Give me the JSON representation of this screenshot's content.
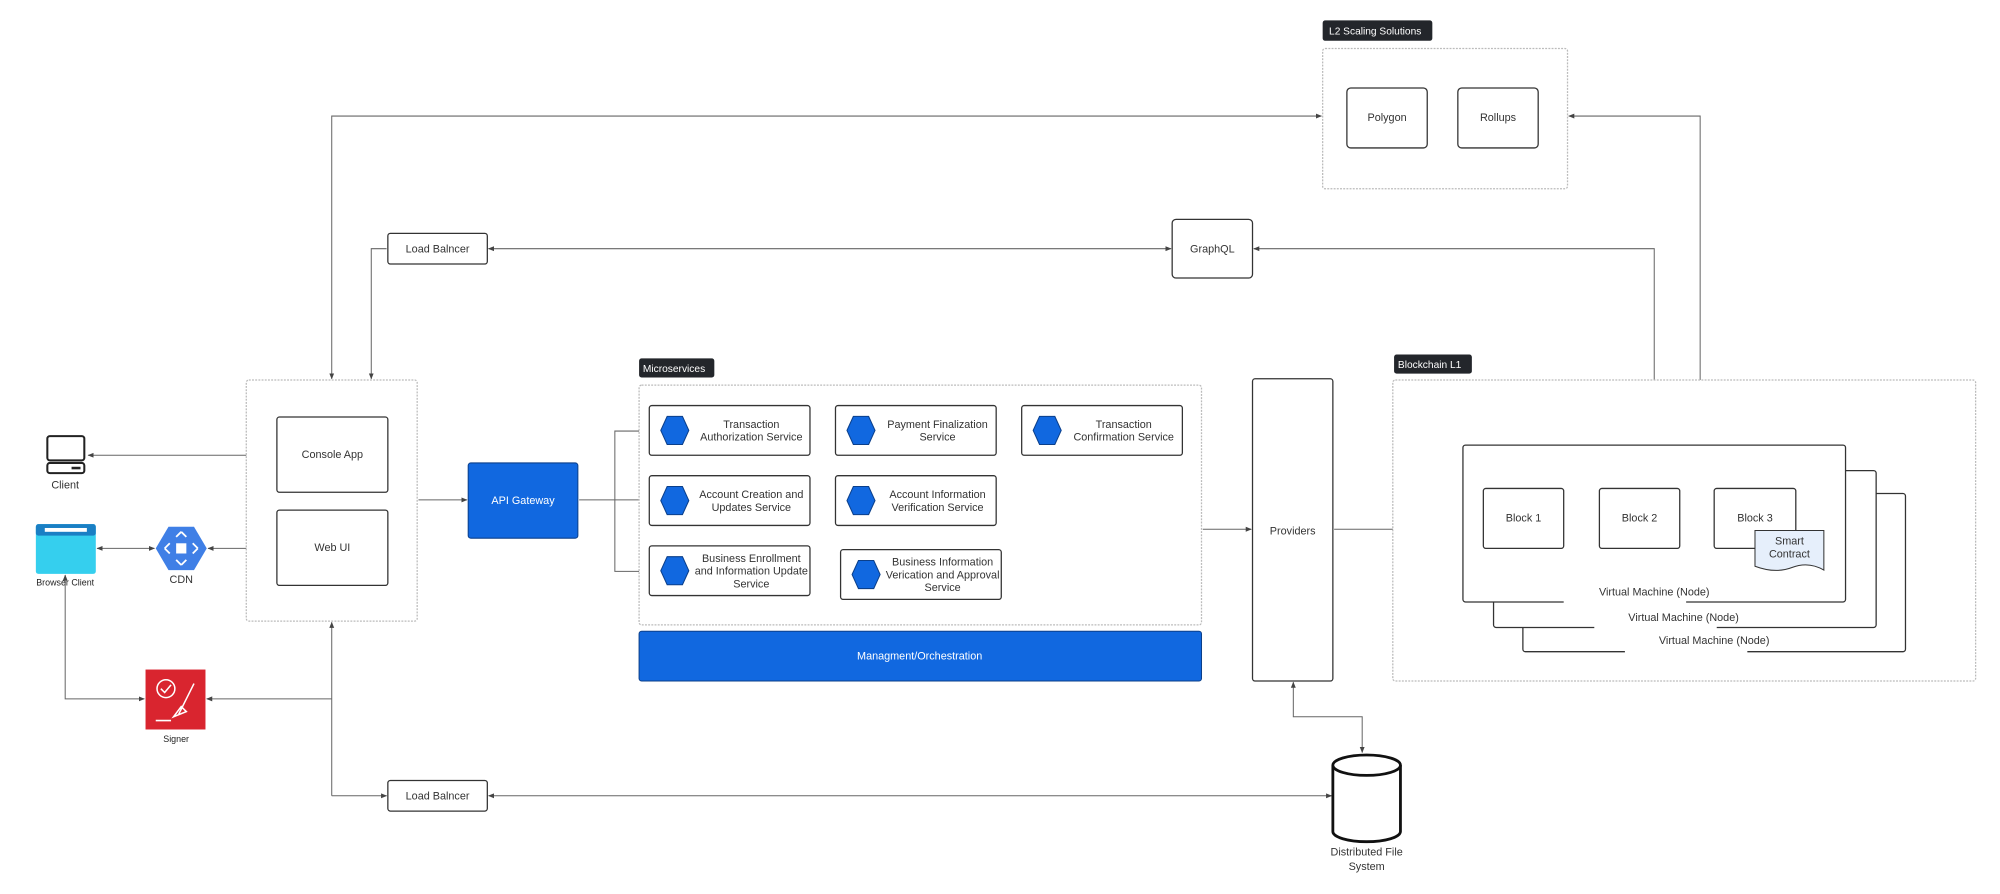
{
  "colors": {
    "accent_blue": "#1168e0",
    "tag_bg": "#23262b",
    "browser_cyan": "#35cfee",
    "signer_red": "#d9252f"
  },
  "l2": {
    "label": "L2 Scaling Solutions",
    "polygon": "Polygon",
    "rollups": "Rollups"
  },
  "load_balancer_top": "Load Balncer",
  "load_balancer_bottom": "Load Balncer",
  "graphql": "GraphQL",
  "client": {
    "label": "Client",
    "icon": "desktop-computer-icon"
  },
  "browser_client": {
    "label": "Browser Client",
    "icon": "browser-window-icon"
  },
  "cdn": {
    "label": "CDN",
    "icon": "cdn-hexagon-icon"
  },
  "signer": {
    "label": "Signer",
    "icon": "signer-certificate-pen-icon"
  },
  "console_app": "Console App",
  "web_ui": "Web UI",
  "api_gateway": "API Gateway",
  "microservices": {
    "label": "Microservices",
    "services": [
      {
        "lines": [
          "Transaction",
          "Authorization Service"
        ]
      },
      {
        "lines": [
          "Payment Finalization",
          "Service"
        ]
      },
      {
        "lines": [
          "Transaction",
          "Confirmation Service"
        ]
      },
      {
        "lines": [
          "Account Creation and",
          "Updates Service"
        ]
      },
      {
        "lines": [
          "Account Information",
          "Verification Service"
        ]
      },
      {
        "lines": [
          "Business Enrollment",
          "and Information Update",
          "Service"
        ]
      },
      {
        "lines": [
          "Business Information",
          "Verication and Approval",
          "Service"
        ]
      }
    ]
  },
  "management": "Managment/Orchestration",
  "providers": "Providers",
  "blockchain": {
    "label": "Blockchain L1",
    "blocks": [
      "Block 1",
      "Block 2",
      "Block 3"
    ],
    "smart_contract": [
      "Smart",
      "Contract"
    ],
    "vm_labels": [
      "Virtual Machine (Node)",
      "Virtual Machine (Node)",
      "Virtual Machine (Node)"
    ]
  },
  "dfs": {
    "lines": [
      "Distributed File",
      "System"
    ]
  }
}
